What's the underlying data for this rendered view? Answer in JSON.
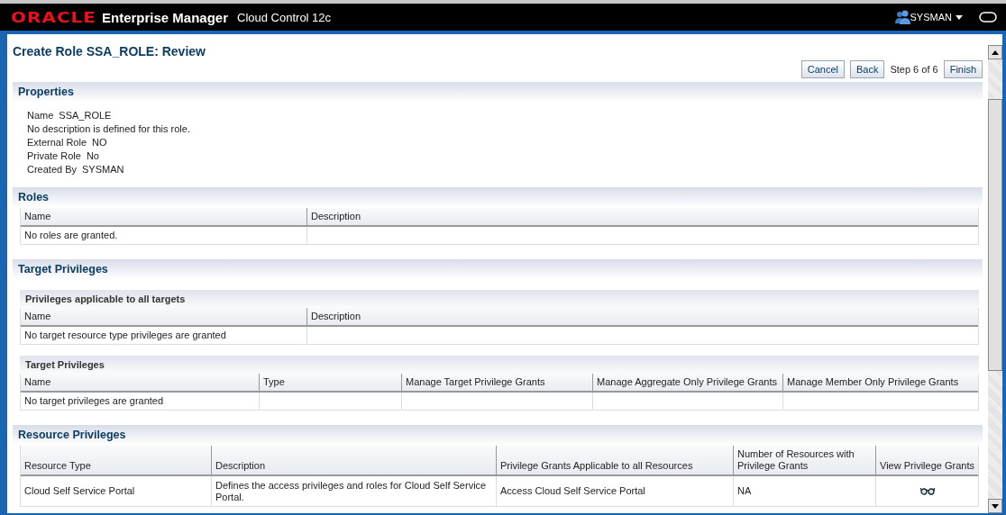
{
  "header": {
    "logo": "ORACLE",
    "product": "Enterprise Manager",
    "subtitle": "Cloud Control 12c",
    "user": "SYSMAN"
  },
  "page": {
    "title": "Create Role SSA_ROLE: Review",
    "buttons": [
      {
        "label": "Cancel",
        "kind": "button"
      },
      {
        "label": "Back",
        "kind": "button"
      },
      {
        "label": "Step 6 of 6",
        "kind": "text"
      },
      {
        "label": "Finish",
        "kind": "button"
      }
    ]
  },
  "properties": {
    "title": "Properties",
    "items": [
      {
        "kind": "field",
        "label": "Name",
        "value": "SSA_ROLE"
      },
      {
        "kind": "note",
        "text": "No description is defined for this role."
      },
      {
        "kind": "field",
        "label": "External Role",
        "value": "NO"
      },
      {
        "kind": "field",
        "label": "Private Role",
        "value": "No"
      },
      {
        "kind": "field",
        "label": "Created By",
        "value": "SYSMAN"
      }
    ]
  },
  "roles": {
    "title": "Roles",
    "table": {
      "columns": [
        "Name",
        "Description"
      ],
      "rows": [
        [
          "No roles are granted.",
          ""
        ]
      ]
    }
  },
  "target_privileges": {
    "title": "Target Privileges",
    "subsections": [
      {
        "title": "Privileges applicable to all targets",
        "table": {
          "columns": [
            "Name",
            "Description"
          ],
          "rows": [
            [
              "No target resource type privileges are granted",
              ""
            ]
          ]
        }
      },
      {
        "title": "Target Privileges",
        "table": {
          "columns": [
            "Name",
            "Type",
            "Manage Target Privilege Grants",
            "Manage Aggregate Only Privilege Grants",
            "Manage Member Only Privilege Grants"
          ],
          "rows": [
            [
              "No target privileges are granted",
              "",
              "",
              "",
              ""
            ]
          ]
        }
      }
    ]
  },
  "resource_privileges": {
    "title": "Resource Privileges",
    "table": {
      "columns": [
        "Resource Type",
        "Description",
        "Privilege Grants Applicable to all Resources",
        "Number of Resources with Privilege Grants",
        "View Privilege Grants"
      ],
      "rows": [
        [
          "Cloud Self Service Portal",
          "Defines the access privileges and roles for Cloud Self Service Portal.",
          "Access Cloud Self Service Portal",
          "NA",
          {
            "kind": "icon"
          }
        ]
      ]
    }
  }
}
